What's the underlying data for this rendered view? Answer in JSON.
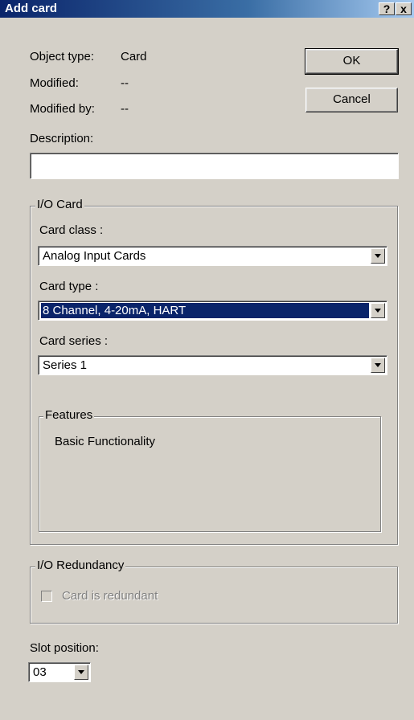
{
  "window": {
    "title": "Add card",
    "help_label": "?",
    "close_label": "x"
  },
  "info": {
    "object_type_label": "Object type:",
    "object_type_value": "Card",
    "modified_label": "Modified:",
    "modified_value": "--",
    "modified_by_label": "Modified by:",
    "modified_by_value": "--"
  },
  "buttons": {
    "ok_label": "OK",
    "cancel_label": "Cancel"
  },
  "description": {
    "label": "Description:",
    "value": ""
  },
  "io_card": {
    "legend": "I/O Card",
    "card_class_label": "Card class :",
    "card_class_value": "Analog Input Cards",
    "card_type_label": "Card type :",
    "card_type_value": "8 Channel, 4-20mA, HART",
    "card_series_label": "Card series :",
    "card_series_value": "Series 1",
    "features_legend": "Features",
    "features_text": "Basic Functionality"
  },
  "io_redundancy": {
    "legend": "I/O Redundancy",
    "checkbox_label": "Card is redundant",
    "checked": false
  },
  "slot": {
    "label": "Slot position:",
    "value": "03"
  },
  "icons": {
    "dropdown": "chevron-down-icon",
    "help": "help-icon",
    "close": "close-icon"
  }
}
